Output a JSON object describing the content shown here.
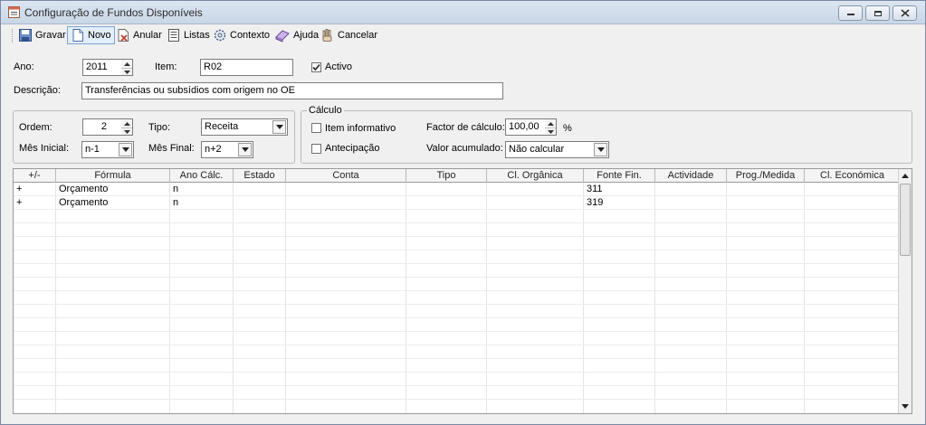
{
  "window": {
    "title": "Configuração de Fundos Disponíveis"
  },
  "toolbar": {
    "gravar": "Gravar",
    "novo": "Novo",
    "anular": "Anular",
    "listas": "Listas",
    "contexto": "Contexto",
    "ajuda": "Ajuda",
    "cancelar": "Cancelar"
  },
  "form": {
    "ano_label": "Ano:",
    "ano_value": "2011",
    "item_label": "Item:",
    "item_value": "R02",
    "activo_label": "Activo",
    "activo_checked": true,
    "descricao_label": "Descrição:",
    "descricao_value": "Transferências ou subsídios com origem no OE",
    "ordem_label": "Ordem:",
    "ordem_value": "2",
    "tipo_label": "Tipo:",
    "tipo_value": "Receita",
    "mes_inicial_label": "Mês Inicial:",
    "mes_inicial_value": "n-1",
    "mes_final_label": "Mês Final:",
    "mes_final_value": "n+2"
  },
  "calculo": {
    "legend": "Cálculo",
    "item_informativo_label": "Item informativo",
    "item_informativo_checked": false,
    "antecipacao_label": "Antecipação",
    "antecipacao_checked": false,
    "factor_label": "Factor de cálculo:",
    "factor_value": "100,00",
    "factor_unit": "%",
    "valor_label": "Valor acumulado:",
    "valor_value": "Não calcular"
  },
  "grid": {
    "headers": [
      "+/-",
      "Fórmula",
      "Ano Cálc.",
      "Estado",
      "Conta",
      "Tipo",
      "Cl. Orgânica",
      "Fonte Fin.",
      "Actividade",
      "Prog./Medida",
      "Cl. Económica"
    ],
    "rows": [
      [
        "+",
        "Orçamento",
        "n",
        "",
        "",
        "",
        "",
        "311",
        "",
        "",
        ""
      ],
      [
        "+",
        "Orçamento",
        "n",
        "",
        "",
        "",
        "",
        "319",
        "",
        "",
        ""
      ]
    ]
  },
  "colors": {
    "titlebar": "#c9d6e7",
    "window_bg": "#f0f0f0",
    "field_border": "#7b7b7b"
  },
  "icons": [
    "app-form-icon",
    "save-icon",
    "new-document-icon",
    "cancel-document-icon",
    "list-icon",
    "context-gear-icon",
    "help-book-icon",
    "cancel-hand-icon"
  ]
}
